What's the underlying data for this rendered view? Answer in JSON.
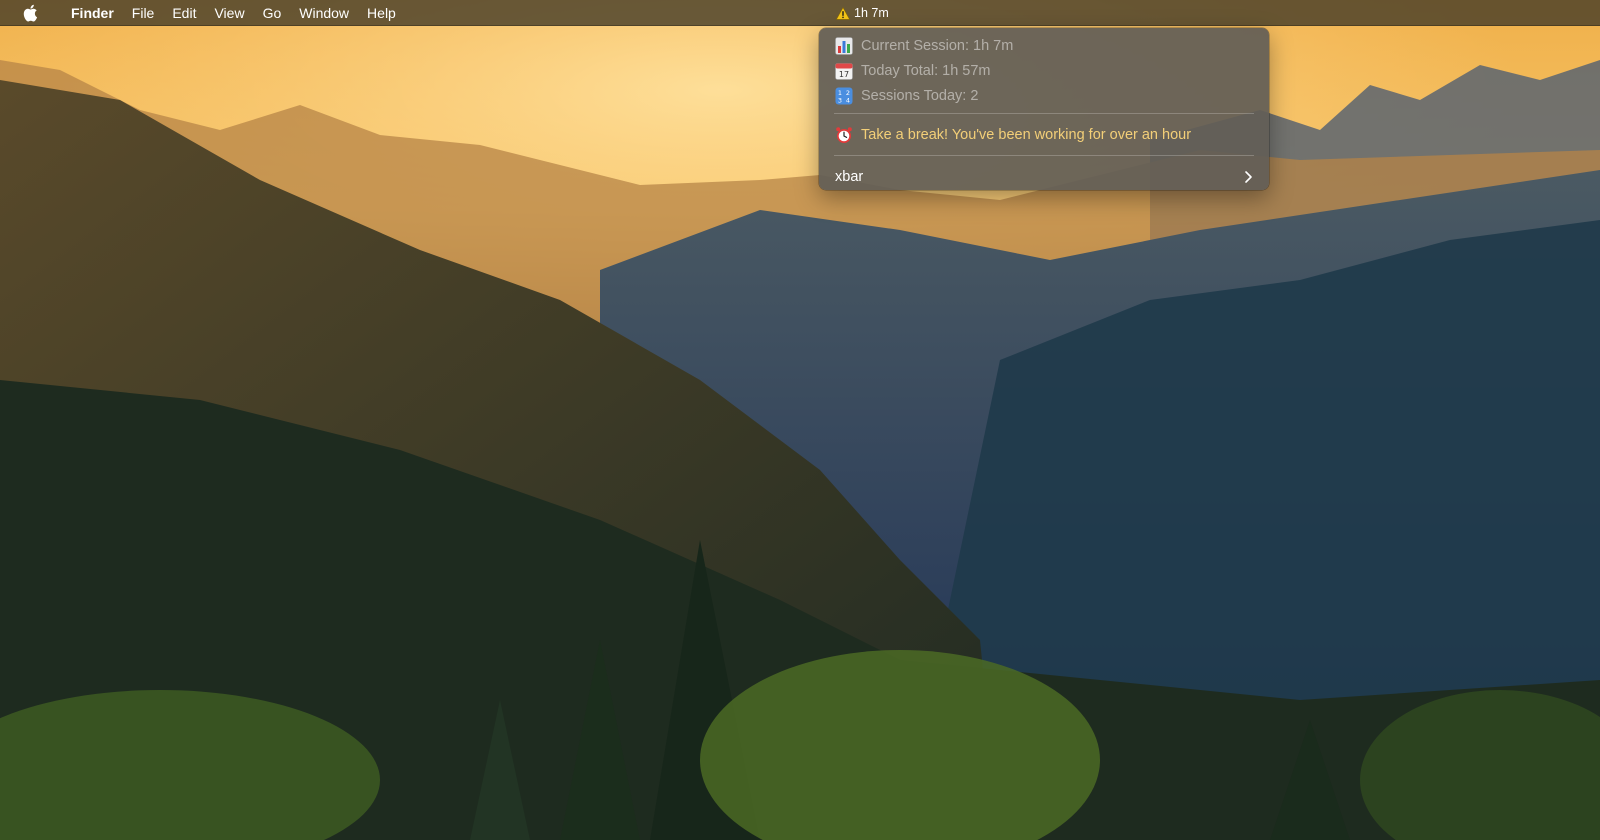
{
  "menubar": {
    "apple_icon": "apple-logo-icon",
    "app_name": "Finder",
    "menus": [
      "File",
      "Edit",
      "View",
      "Go",
      "Window",
      "Help"
    ],
    "status": {
      "icon": "warning-icon",
      "label": "1h 7m"
    }
  },
  "dropdown": {
    "items": [
      {
        "icon": "bar-chart-icon",
        "label": "Current Session: 1h 7m",
        "enabled": false
      },
      {
        "icon": "calendar-icon",
        "label": "Today Total: 1h 57m",
        "enabled": false
      },
      {
        "icon": "numbers-icon",
        "label": "Sessions Today: 2",
        "enabled": false
      }
    ],
    "alert": {
      "icon": "alarm-clock-icon",
      "label": "Take a break! You've been working for over an hour",
      "color": "#f3cf78"
    },
    "submenu": {
      "label": "xbar",
      "icon": "chevron-right-icon"
    }
  },
  "colors": {
    "menubar_bg": "#483e28",
    "dropdown_bg": "#625e56",
    "alert_text": "#f3cf78",
    "warning_yellow": "#f5c518"
  }
}
